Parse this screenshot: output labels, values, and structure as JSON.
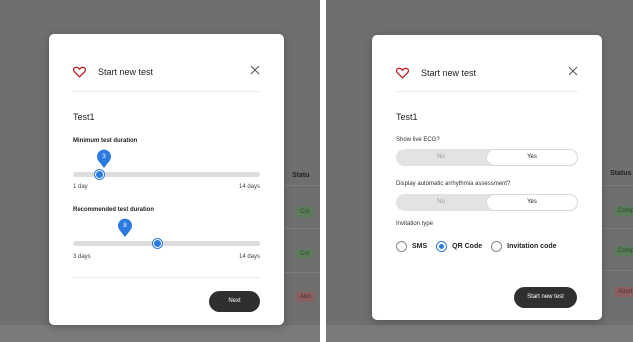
{
  "left": {
    "background_table": {
      "status_header": "Statu",
      "badges": [
        {
          "text": "Cor",
          "tone": "green"
        },
        {
          "text": "Cor",
          "tone": "green"
        },
        {
          "text": "Abo",
          "tone": "red"
        }
      ]
    },
    "modal": {
      "title": "Start new test",
      "test_name": "Test1",
      "min_duration": {
        "label": "Minimum test duration",
        "value": "3",
        "value_fraction": 0.14,
        "min_label": "1 day",
        "max_label": "14 days"
      },
      "recommended_duration": {
        "label": "Recommended test duration",
        "value": "8",
        "value_fraction": 0.45,
        "min_label": "3 days",
        "max_label": "14 days"
      },
      "next_label": "Next"
    }
  },
  "right": {
    "background_table": {
      "status_header": "Status",
      "badges": [
        {
          "text": "Comp",
          "tone": "green"
        },
        {
          "text": "Comp",
          "tone": "green"
        },
        {
          "text": "Abort",
          "tone": "red"
        }
      ]
    },
    "modal": {
      "title": "Start new test",
      "test_name": "Test1",
      "show_ecg": {
        "label": "Show live ECG?",
        "no": "No",
        "yes": "Yes",
        "selected": "Yes"
      },
      "arrhythmia": {
        "label": "Display automatic arrhythmia assessment?",
        "no": "No",
        "yes": "Yes",
        "selected": "Yes"
      },
      "invitation": {
        "label": "Invitation type",
        "options": [
          "SMS",
          "QR Code",
          "Invitation code"
        ],
        "selected": "QR Code"
      },
      "start_label": "Start new test"
    }
  },
  "colors": {
    "accent": "#2d7be0",
    "heart": "#c0282d",
    "button": "#2f2f2f",
    "overlay": "#6f6f6f"
  }
}
